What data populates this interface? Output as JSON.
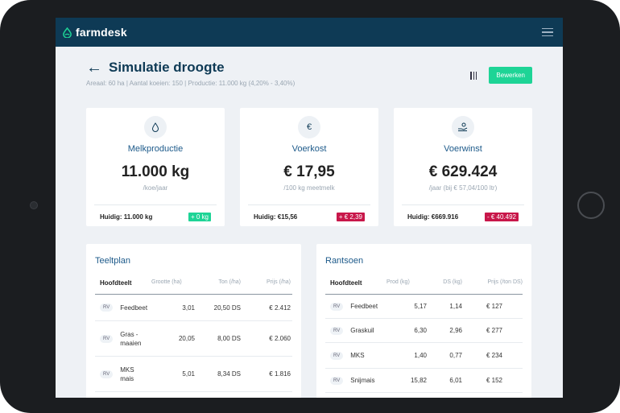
{
  "app": {
    "logo_text": "farmdesk"
  },
  "header": {
    "title": "Simulatie droogte",
    "subtitle": "Areaal: 60 ha | Aantal koeien: 150 | Productie:  11.000 kg (4,20% - 3,40%)",
    "edit_label": "Bewerken"
  },
  "cards": [
    {
      "label": "Melkproductie",
      "value": "11.000 kg",
      "unit": "/koe/jaar",
      "current": "Huidig: 11.000 kg",
      "badge": "+ 0 kg",
      "icon": "drop-icon"
    },
    {
      "label": "Voerkost",
      "value": "€ 17,95",
      "unit": "/100 kg meetmelk",
      "current": "Huidig: €15,56",
      "badge": "+ € 2,39",
      "icon": "euro-icon"
    },
    {
      "label": "Voerwinst",
      "value": "€ 629.424",
      "unit": "/jaar (bij € 57,04/100 ltr)",
      "current": "Huidig: €669.916",
      "badge": "- € 40.492",
      "icon": "hand-coin-icon"
    }
  ],
  "colors": {
    "accent": "#1ed496",
    "negative": "#c8174a",
    "topbar": "#0e3a55"
  },
  "teeltplan": {
    "title": "Teeltplan",
    "headers": [
      "Hoofdteelt",
      "Grootte (ha)",
      "Ton (/ha)",
      "Prijs (/ha)"
    ],
    "rows": [
      {
        "tag": "RV",
        "name": "Feedbeet",
        "c1": "3,01",
        "c2": "20,50 DS",
        "c3": "€ 2.412"
      },
      {
        "tag": "RV",
        "name": "Gras - maaien",
        "c1": "20,05",
        "c2": "8,00 DS",
        "c3": "€ 2.060"
      },
      {
        "tag": "RV",
        "name": "MKS mais",
        "c1": "5,01",
        "c2": "8,34 DS",
        "c3": "€ 1.816"
      }
    ]
  },
  "rantsoen": {
    "title": "Rantsoen",
    "headers": [
      "Hoofdteelt",
      "Prod (kg)",
      "DS (kg)",
      "Prijs (/ton DS)"
    ],
    "rows": [
      {
        "tag": "RV",
        "name": "Feedbeet",
        "c1": "5,17",
        "c2": "1,14",
        "c3": "€ 127"
      },
      {
        "tag": "RV",
        "name": "Graskuil",
        "c1": "6,30",
        "c2": "2,96",
        "c3": "€ 277"
      },
      {
        "tag": "RV",
        "name": "MKS",
        "c1": "1,40",
        "c2": "0,77",
        "c3": "€ 234"
      },
      {
        "tag": "RV",
        "name": "Snijmais",
        "c1": "15,82",
        "c2": "6,01",
        "c3": "€ 152"
      }
    ]
  }
}
